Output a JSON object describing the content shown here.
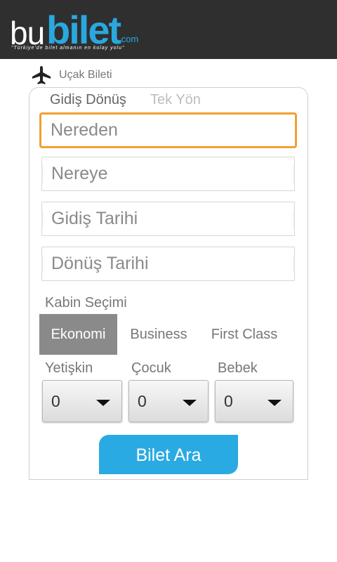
{
  "brand": {
    "logo_prefix": "bu",
    "logo_main": "bilet",
    "logo_suffix": ".com",
    "tagline": "\"Türkiye'de bilet almanın en kolay yolu\"",
    "accent_color": "#29a8e0"
  },
  "section": {
    "icon": "airplane-icon",
    "title": "Uçak Bileti"
  },
  "trip_type": {
    "options": [
      "Gidiş Dönüş",
      "Tek Yön"
    ],
    "selected": "Gidiş Dönüş"
  },
  "fields": {
    "from": "Nereden",
    "to": "Nereye",
    "departure_date": "Gidiş Tarihi",
    "return_date": "Dönüş Tarihi"
  },
  "cabin": {
    "label": "Kabin Seçimi",
    "options": [
      "Ekonomi",
      "Business",
      "First Class"
    ],
    "selected": "Ekonomi"
  },
  "passengers": [
    {
      "label": "Yetişkin",
      "value": "0"
    },
    {
      "label": "Çocuk",
      "value": "0"
    },
    {
      "label": "Bebek",
      "value": "0"
    }
  ],
  "search_button": "Bilet Ara",
  "focus_color": "#f0a030",
  "button_color": "#2aaae2"
}
